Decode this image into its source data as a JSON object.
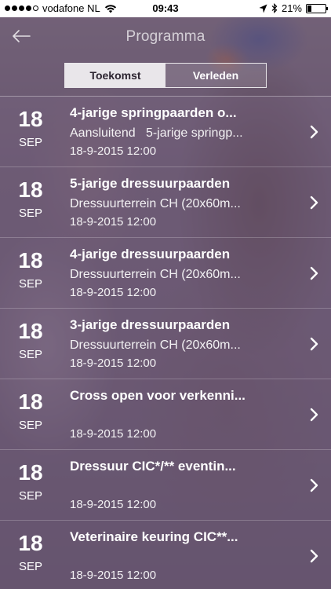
{
  "status_bar": {
    "carrier": "vodafone NL",
    "time": "09:43",
    "battery": "21%",
    "battery_level": 0.21
  },
  "nav": {
    "title": "Programma",
    "back_icon": "arrow-left-icon"
  },
  "tabs": [
    {
      "label": "Toekomst",
      "active": true
    },
    {
      "label": "Verleden",
      "active": false
    }
  ],
  "events": [
    {
      "day": "18",
      "month": "SEP",
      "title": "4-jarige springpaarden o...",
      "location": "Aansluitend   5-jarige springp...",
      "datetime": "18-9-2015 12:00"
    },
    {
      "day": "18",
      "month": "SEP",
      "title": "5-jarige dressuurpaarden",
      "location": "Dressuurterrein CH (20x60m...",
      "datetime": "18-9-2015 12:00"
    },
    {
      "day": "18",
      "month": "SEP",
      "title": "4-jarige dressuurpaarden",
      "location": "Dressuurterrein CH (20x60m...",
      "datetime": "18-9-2015 12:00"
    },
    {
      "day": "18",
      "month": "SEP",
      "title": "3-jarige dressuurpaarden",
      "location": "Dressuurterrein CH (20x60m...",
      "datetime": "18-9-2015 12:00"
    },
    {
      "day": "18",
      "month": "SEP",
      "title": "Cross open voor verkenni...",
      "location": "",
      "datetime": "18-9-2015 12:00"
    },
    {
      "day": "18",
      "month": "SEP",
      "title": "Dressuur CIC*/** eventin...",
      "location": "",
      "datetime": "18-9-2015 12:00"
    },
    {
      "day": "18",
      "month": "SEP",
      "title": "Veterinaire keuring CIC**...",
      "location": "",
      "datetime": "18-9-2015 12:00"
    }
  ]
}
